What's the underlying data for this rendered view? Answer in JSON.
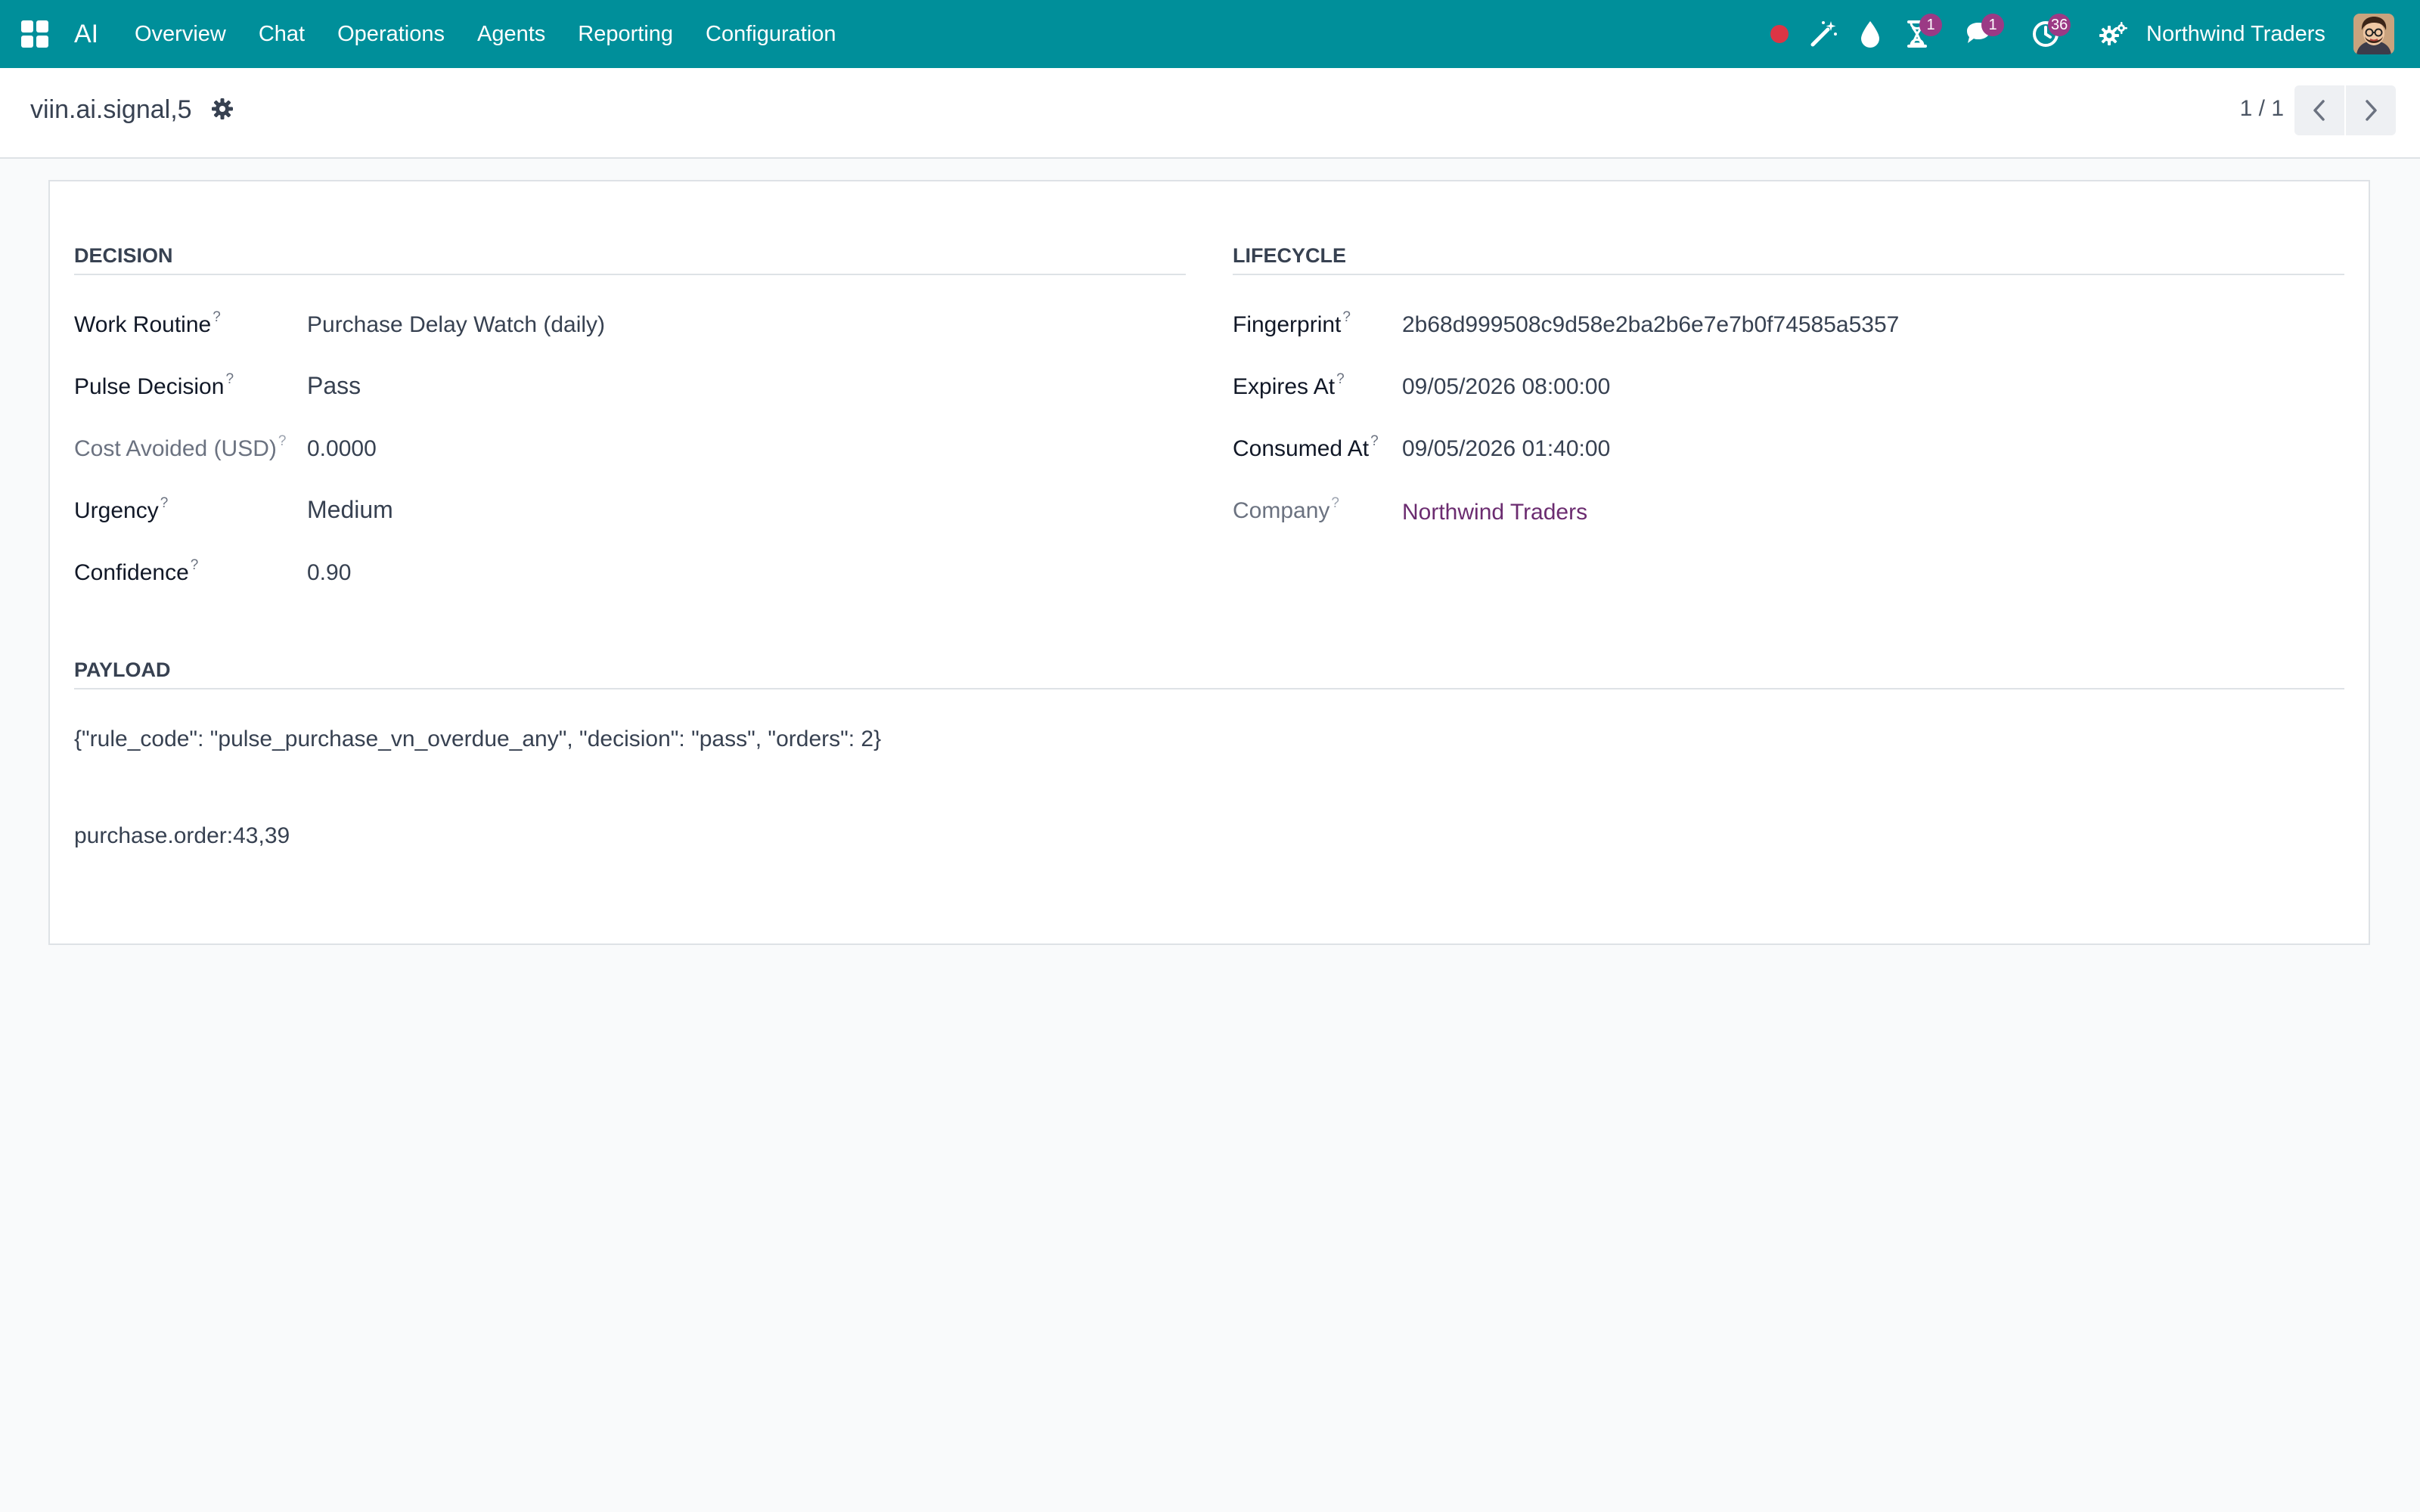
{
  "navbar": {
    "brand": "AI",
    "menu": [
      "Overview",
      "Chat",
      "Operations",
      "Agents",
      "Reporting",
      "Configuration"
    ],
    "badges": {
      "activity": "1",
      "messages": "1",
      "clock": "36"
    },
    "company": "Northwind Traders",
    "icons": [
      "apps-grid-icon",
      "record-dot-icon",
      "magic-wand-icon",
      "drop-icon",
      "hourglass-icon",
      "chat-icon",
      "clock-icon",
      "gears-icon",
      "user-avatar"
    ],
    "accent": "#008f9a",
    "badge_color": "#9b3a85",
    "record_dot_color": "#dc3545"
  },
  "control_panel": {
    "title": "viin.ai.signal,5",
    "pager": "1 / 1"
  },
  "form": {
    "decision": {
      "title": "DECISION",
      "fields": [
        {
          "label": "Work Routine",
          "value": "Purchase Delay Watch (daily)"
        },
        {
          "label": "Pulse Decision",
          "value": "Pass"
        },
        {
          "label": "Cost Avoided (USD)",
          "value": "0.0000"
        },
        {
          "label": "Urgency",
          "value": "Medium"
        },
        {
          "label": "Confidence",
          "value": "0.90"
        }
      ]
    },
    "lifecycle": {
      "title": "LIFECYCLE",
      "fields": [
        {
          "label": "Fingerprint",
          "value": "2b68d999508c9d58e2ba2b6e7e7b0f74585a5357"
        },
        {
          "label": "Expires At",
          "value": "09/05/2026 08:00:00"
        },
        {
          "label": "Consumed At",
          "value": "09/05/2026 01:40:00"
        },
        {
          "label": "Company",
          "value": "Northwind Traders"
        }
      ]
    },
    "payload": {
      "title": "PAYLOAD",
      "json_text": "{\"rule_code\": \"pulse_purchase_vn_overdue_any\", \"decision\": \"pass\", \"orders\": 2}",
      "reference": "purchase.order:43,39"
    },
    "help_marker": "?"
  }
}
